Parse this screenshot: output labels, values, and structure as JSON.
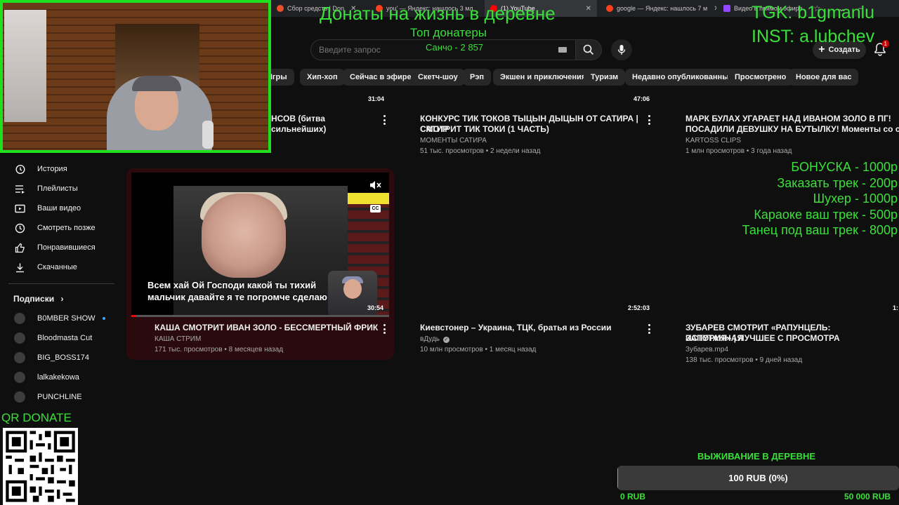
{
  "browser": {
    "tabs": [
      {
        "label": "Сбор средств | Don",
        "active": false,
        "color": "#e94f2a"
      },
      {
        "label": "you' — Яндекс: нашлось 3 мл",
        "active": false,
        "color": "#fc3f1d"
      },
      {
        "label": "(1) YouTube",
        "active": true,
        "color": "#ff0000"
      },
      {
        "label": "google — Яндекс: нашлось 7 м",
        "active": false,
        "color": "#fc3f1d"
      },
      {
        "label": "Видео в прямом эфире",
        "active": false,
        "color": "#9146ff"
      }
    ]
  },
  "header": {
    "search_placeholder": "Введите запрос",
    "create_label": "Создать",
    "bell_count": "1"
  },
  "chips": [
    "Игры",
    "Хип-хоп",
    "Сейчас в эфире",
    "Скетч-шоу",
    "Рэп",
    "Экшен и приключения",
    "Туризм",
    "Недавно опубликованные",
    "Просмотрено",
    "Новое для вас"
  ],
  "sidebar": {
    "items": [
      {
        "label": "История",
        "icon": "history-icon"
      },
      {
        "label": "Плейлисты",
        "icon": "playlist-icon"
      },
      {
        "label": "Ваши видео",
        "icon": "your-videos-icon"
      },
      {
        "label": "Смотреть позже",
        "icon": "watch-later-icon"
      },
      {
        "label": "Понравившиеся",
        "icon": "like-icon"
      },
      {
        "label": "Скачанные",
        "icon": "download-icon"
      }
    ],
    "subs_title": "Подписки",
    "subscriptions": [
      {
        "label": "B0MBER SHOW",
        "live": true
      },
      {
        "label": "Bloodmasta Cut",
        "live": false
      },
      {
        "label": "BIG_BOSS174",
        "live": false
      },
      {
        "label": "lalkakekowa",
        "live": false
      },
      {
        "label": "PUNCHLINE",
        "live": false
      }
    ]
  },
  "videos_row1": [
    {
      "title_line1": "НСОВ (битва сильнейших)",
      "title_line2": "",
      "channel": "",
      "meta": "",
      "duration": "31:04"
    },
    {
      "title_line1": "КОНКУРС ТИК ТОКОВ ТЫЦЫН ДЫЦЫН ОТ САТИРА | САТИР",
      "title_line2": "СМОТРИТ ТИК ТОКИ (1 ЧАСТЬ)",
      "channel": "МОМЕНТЫ САТИРА",
      "meta": "51 тыс. просмотров • 2 недели назад",
      "duration": "47:06"
    },
    {
      "title_line1": "МАРК БУЛАХ УГАРАЕТ НАД ИВАНОМ ЗОЛО В ПГ!",
      "title_line2": "ПОСАДИЛИ ДЕВУШКУ НА БУТЫЛКУ! Моменты со стрима",
      "channel": "KARTOSS CLIPS",
      "meta": "1 млн просмотров • 3 года назад",
      "duration": ""
    }
  ],
  "videos_row2": [
    {
      "title_line1": "КАША СМОТРИТ ИВАН ЗОЛО - БЕССМЕРТНЫЙ ФРИК",
      "title_line2": "",
      "channel": "КАША СТРИМ",
      "meta": "171 тыс. просмотров • 8 месяцев назад",
      "duration": "30:54"
    },
    {
      "title_line1": "Киевстонер – Украина, ТЦК, братья из России",
      "title_line2": "",
      "channel": "вДудь",
      "meta": "10 млн просмотров • 1 месяц назад",
      "duration": "2:52:03"
    },
    {
      "title_line1": "ЗУБАРЕВ СМОТРИТ «РАПУНЦЕЛЬ: ЗАПУТАННАЯ",
      "title_line2": "ИСТОРИЯ» | ЛУЧШЕЕ С ПРОСМОТРА",
      "channel": "Зубарев.mp4",
      "meta": "138 тыс. просмотров • 9 дней назад",
      "duration": "1:"
    }
  ],
  "preview": {
    "caption_line1": "Всем хай Ой Господи какой ты тихий",
    "caption_line2": "мальчик давайте я те погромче сделаю",
    "cc_label": "CC",
    "progress": 0.02
  },
  "overlay": {
    "title": "Донаты на жизнь в деревне",
    "top_title": "Топ донатеры",
    "top_donor": "Санчо - 2 857",
    "tgk": "TGK: b1gmanlu",
    "inst": "INST: a.lubchev",
    "prices": [
      "БОНУСКА - 1000р",
      "Заказать трек - 200р",
      "Шухер - 1000р",
      "Караоке ваш трек - 500р",
      "Танец под ваш трек - 800р"
    ],
    "qr_label": "QR DONATE",
    "goal_title": "ВЫЖИВАНИЕ В ДЕРЕВНЕ",
    "goal_text": "100 RUB (0%)",
    "goal_min": "0 RUB",
    "goal_max": "50 000 RUB",
    "goal_progress": 0.002,
    "accent": "#3ae03a"
  }
}
